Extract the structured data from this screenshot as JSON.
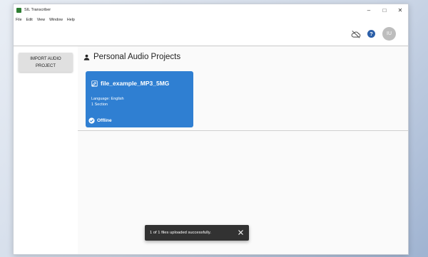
{
  "window": {
    "title": "SIL Transcriber"
  },
  "menu": {
    "items": [
      "File",
      "Edit",
      "View",
      "Window",
      "Help"
    ]
  },
  "toolbar": {
    "avatar_initials": "IU"
  },
  "sidebar": {
    "import_button": "IMPORT AUDIO PROJECT"
  },
  "main": {
    "section_title": "Personal Audio Projects",
    "project": {
      "title": "file_example_MP3_5MG",
      "language": "Language: English",
      "sections": "1 Section",
      "status": "Offline"
    }
  },
  "toast": {
    "message": "1 of 1 files uploaded successfully."
  },
  "colors": {
    "card_blue": "#2f7fd2",
    "help_blue": "#2c5fa8",
    "toast_bg": "#323232"
  }
}
